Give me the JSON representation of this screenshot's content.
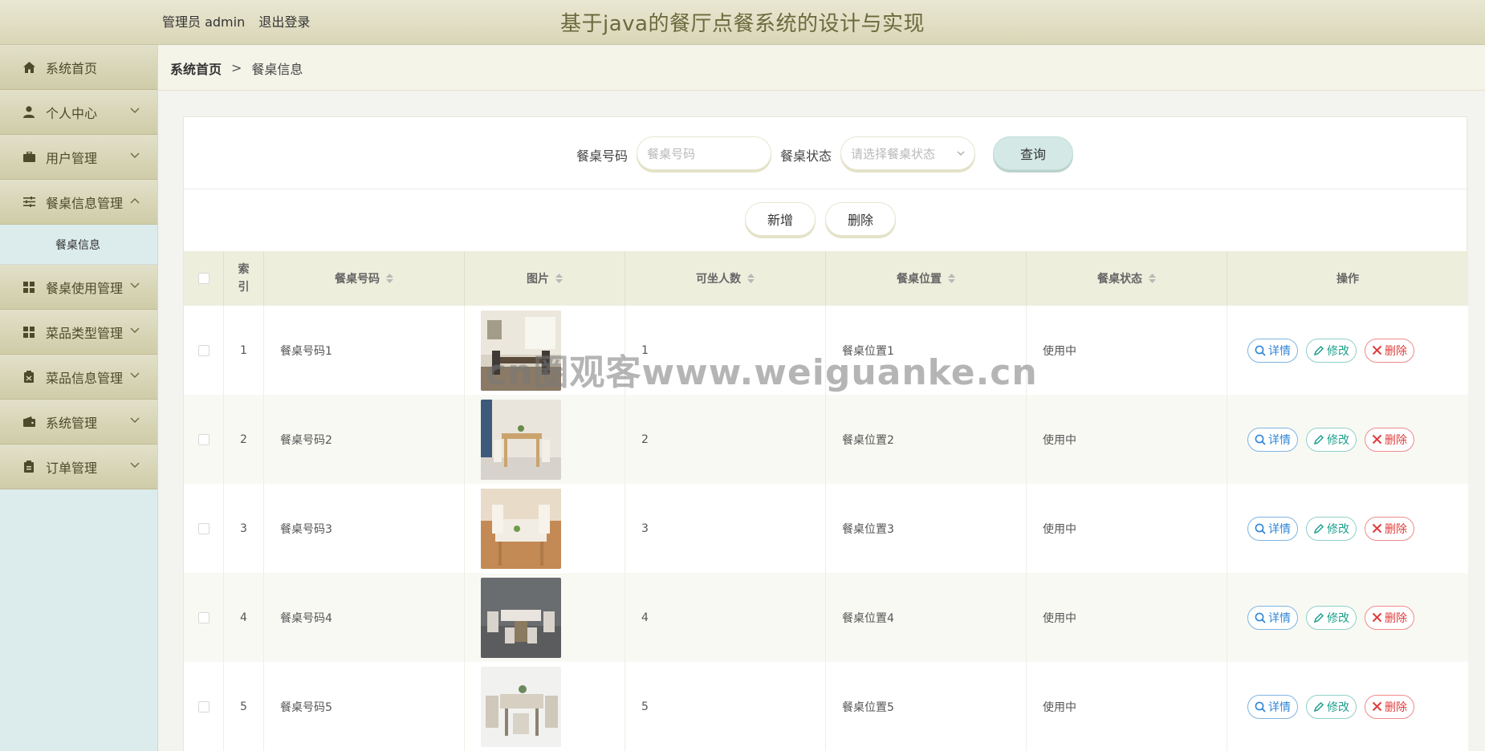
{
  "header": {
    "admin_label": "管理员 admin",
    "logout_label": "退出登录",
    "title": "基于java的餐厅点餐系统的设计与实现"
  },
  "sidebar": {
    "items": [
      {
        "label": "系统首页",
        "icon": "home-icon",
        "has_arrow": false
      },
      {
        "label": "个人中心",
        "icon": "user-icon",
        "has_arrow": true
      },
      {
        "label": "用户管理",
        "icon": "briefcase-icon",
        "has_arrow": true
      },
      {
        "label": "餐桌信息管理",
        "icon": "sliders-icon",
        "has_arrow": true,
        "expanded": true
      },
      {
        "label": "餐桌使用管理",
        "icon": "grid-icon",
        "has_arrow": true
      },
      {
        "label": "菜品类型管理",
        "icon": "grid-icon",
        "has_arrow": true
      },
      {
        "label": "菜品信息管理",
        "icon": "clipboard-icon",
        "has_arrow": true
      },
      {
        "label": "系统管理",
        "icon": "wallet-icon",
        "has_arrow": true
      },
      {
        "label": "订单管理",
        "icon": "clipboard-icon",
        "has_arrow": true
      }
    ],
    "sub_item": "餐桌信息"
  },
  "breadcrumb": {
    "home": "系统首页",
    "separator": ">",
    "current": "餐桌信息"
  },
  "search": {
    "table_no_label": "餐桌号码",
    "table_no_placeholder": "餐桌号码",
    "status_label": "餐桌状态",
    "status_placeholder": "请选择餐桌状态",
    "query_label": "查询"
  },
  "actions": {
    "add_label": "新增",
    "delete_label": "删除"
  },
  "table": {
    "headers": {
      "index": "索引",
      "table_no": "餐桌号码",
      "image": "图片",
      "capacity": "可坐人数",
      "position": "餐桌位置",
      "status": "餐桌状态",
      "operation": "操作"
    },
    "rows": [
      {
        "index": "1",
        "table_no": "餐桌号码1",
        "capacity": "1",
        "position": "餐桌位置1",
        "status": "使用中"
      },
      {
        "index": "2",
        "table_no": "餐桌号码2",
        "capacity": "2",
        "position": "餐桌位置2",
        "status": "使用中"
      },
      {
        "index": "3",
        "table_no": "餐桌号码3",
        "capacity": "3",
        "position": "餐桌位置3",
        "status": "使用中"
      },
      {
        "index": "4",
        "table_no": "餐桌号码4",
        "capacity": "4",
        "position": "餐桌位置4",
        "status": "使用中"
      },
      {
        "index": "5",
        "table_no": "餐桌号码5",
        "capacity": "5",
        "position": "餐桌位置5",
        "status": "使用中"
      }
    ],
    "row_actions": {
      "detail": "详情",
      "edit": "修改",
      "delete": "删除"
    }
  },
  "watermark": "cn圈观客www.weiguanke.cn",
  "colors": {
    "accent": "#6b6a3d",
    "detail": "#2f86d8",
    "edit": "#1e9f8c",
    "delete": "#e03c3c"
  }
}
